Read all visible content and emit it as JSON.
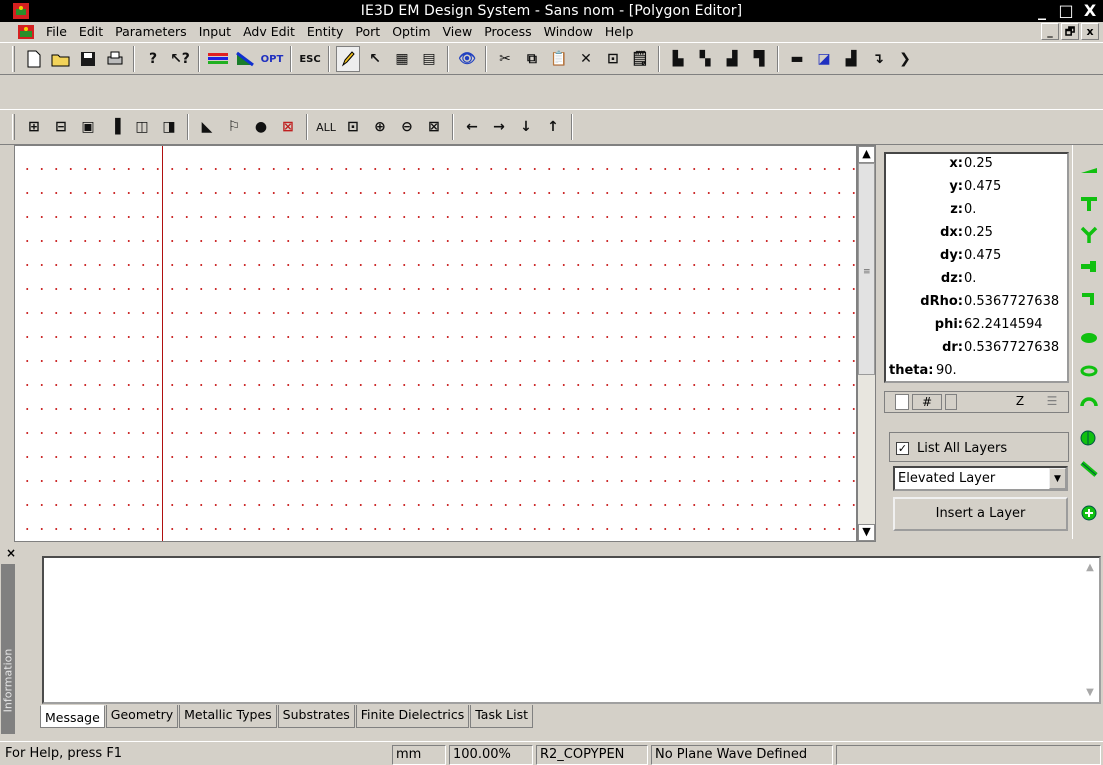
{
  "window": {
    "title": "IE3D EM Design System - Sans nom - [Polygon Editor]",
    "controls": {
      "minimize": "_",
      "maximize": "□",
      "close": "X"
    }
  },
  "menu": {
    "items": [
      "File",
      "Edit",
      "Parameters",
      "Input",
      "Adv Edit",
      "Entity",
      "Port",
      "Optim",
      "View",
      "Process",
      "Window",
      "Help"
    ],
    "mdi": {
      "minimize": "_",
      "restore": "🗗",
      "close": "x"
    }
  },
  "toolbar1": {
    "opt_label": "OPT",
    "esc_label": "ESC"
  },
  "toolbar2": {
    "all_label": "ALL"
  },
  "coords": {
    "x": {
      "label": "x:",
      "value": "0.25"
    },
    "y": {
      "label": "y:",
      "value": "0.475"
    },
    "z": {
      "label": "z:",
      "value": "0."
    },
    "dx": {
      "label": "dx:",
      "value": "0.25"
    },
    "dy": {
      "label": "dy:",
      "value": "0.475"
    },
    "dz": {
      "label": "dz:",
      "value": "0."
    },
    "drho": {
      "label": "dRho:",
      "value": "0.5367727638"
    },
    "phi": {
      "label": "phi:",
      "value": "62.2414594"
    },
    "dr": {
      "label": "dr:",
      "value": "0.5367727638"
    },
    "theta": {
      "label": "theta:",
      "value": "90."
    }
  },
  "layer_strip": {
    "hash": "#",
    "z": "Z"
  },
  "layers": {
    "list_all_label": "List All Layers",
    "list_all_checked": "✓",
    "selected": "Elevated Layer",
    "insert_button": "Insert a Layer"
  },
  "info": {
    "side_label": "Information",
    "close": "×",
    "tabs": [
      "Message",
      "Geometry",
      "Metallic Types",
      "Substrates",
      "Finite Dielectrics",
      "Task List"
    ],
    "active_tab": "Message"
  },
  "status": {
    "help": "For Help, press F1",
    "units": "mm",
    "zoom": "100.00%",
    "command": "R2_COPYPEN",
    "plane_wave": "No Plane Wave Defined"
  },
  "colors": {
    "grid_dot": "#cc2b2b",
    "axis_line": "#b01010",
    "tool_green": "#10c010"
  }
}
